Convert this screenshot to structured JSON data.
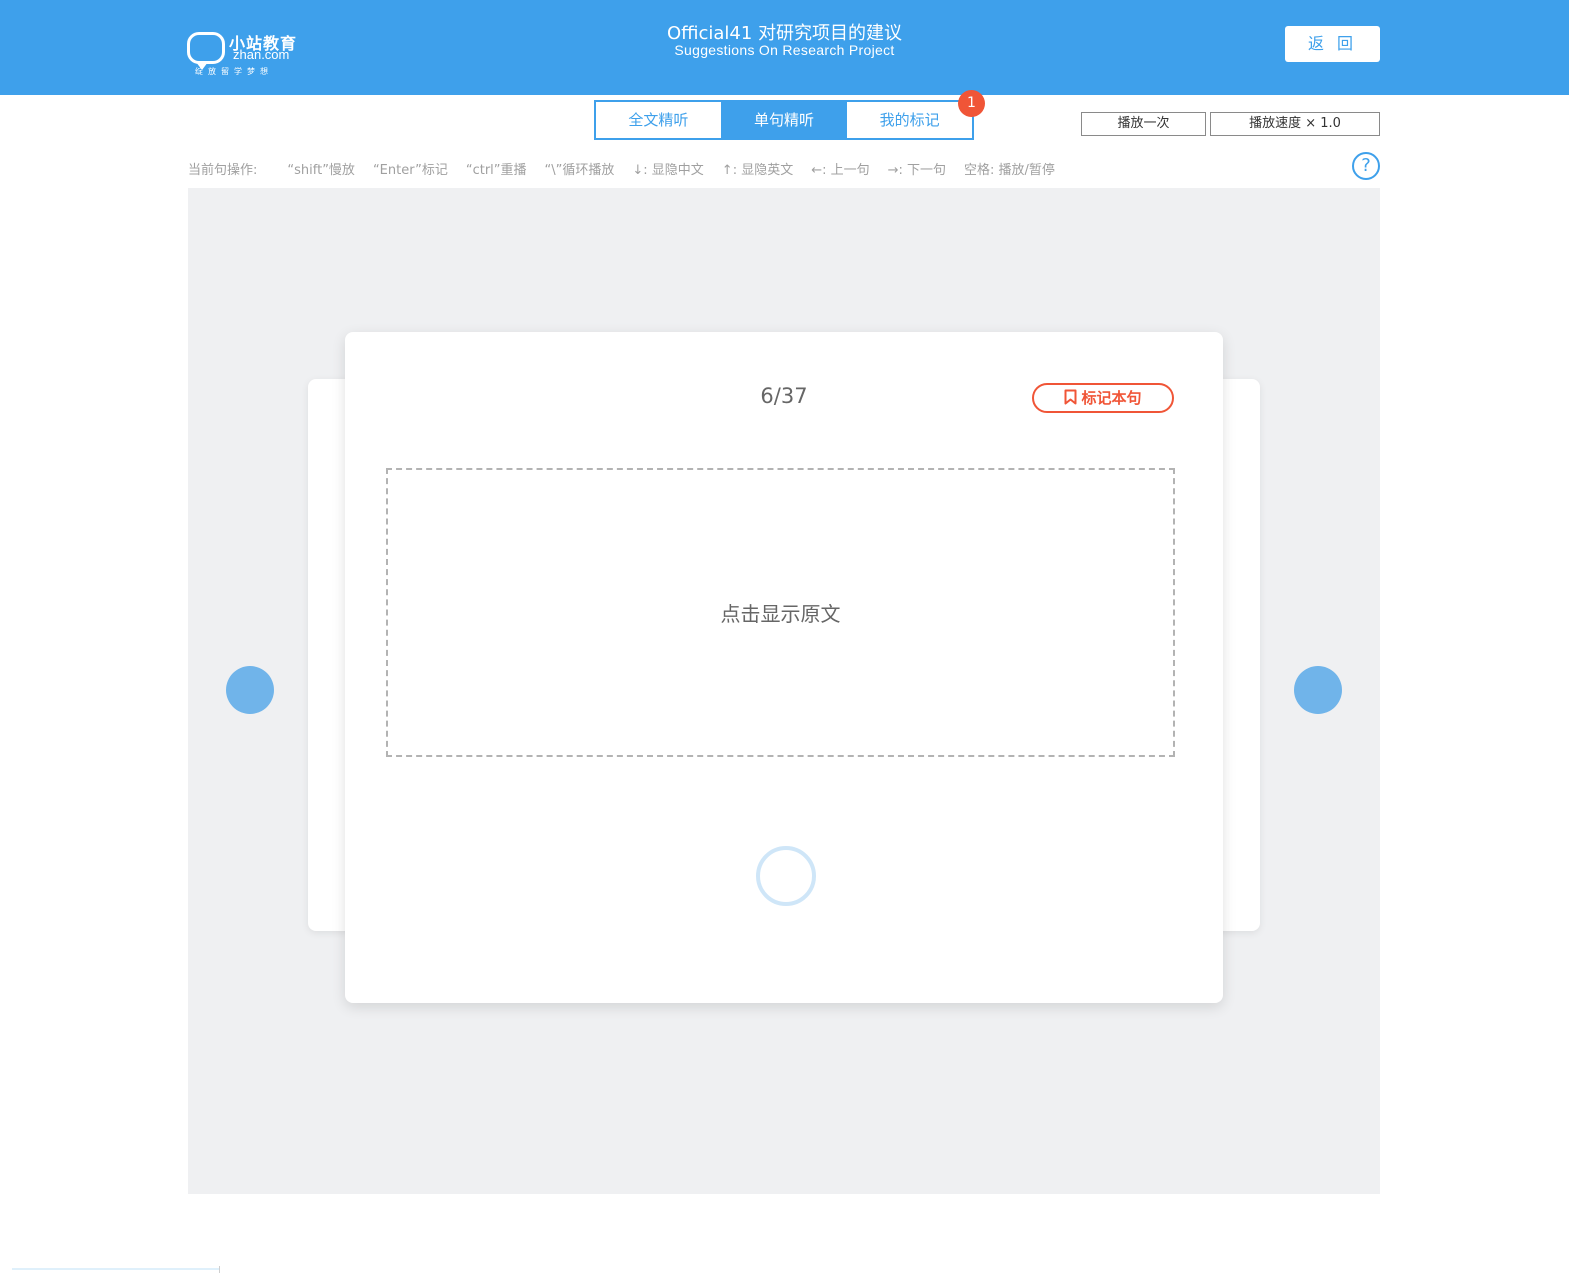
{
  "header": {
    "logo": {
      "brand_cn": "小站教育",
      "brand_en": "zhan.com",
      "slogan": "绽放留学梦想"
    },
    "title_cn": "Official41 对研究项目的建议",
    "title_en": "Suggestions On Research Project",
    "back_label": "返 回",
    "background_color": "#3ea0eb"
  },
  "tabs": [
    {
      "label": "全文精听",
      "active": false
    },
    {
      "label": "单句精听",
      "active": true
    },
    {
      "label": "我的标记",
      "active": false
    }
  ],
  "tab_badge": "1",
  "controls": {
    "play_mode": "播放一次",
    "speed": "播放速度 × 1.0"
  },
  "shortcuts": {
    "label": "当前句操作:",
    "items": [
      "“shift”慢放",
      "“Enter”标记",
      "“ctrl”重播",
      "“\\”循环播放",
      "↓: 显隐中文",
      "↑: 显隐英文",
      "←: 上一句",
      "→: 下一句",
      "空格: 播放/暂停"
    ]
  },
  "help_icon": "question-circle-icon",
  "card": {
    "counter": "6/37",
    "mark_label": "标记本句",
    "reveal_label": "点击显示原文"
  },
  "colors": {
    "accent": "#3ea0eb",
    "mark": "#f05537",
    "stage_bg": "#eff0f2",
    "nav_button": "#70b4ea"
  }
}
